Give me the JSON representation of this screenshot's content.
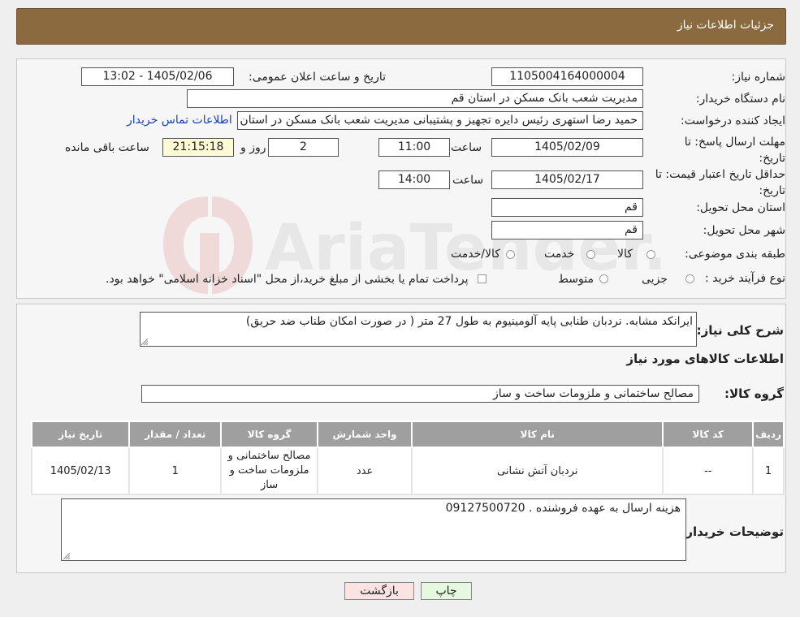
{
  "header": {
    "title": "جزئیات اطلاعات نیاز"
  },
  "form": {
    "need_number_label": "شماره نیاز:",
    "need_number": "1105004164000004",
    "announce_label": "تاریخ و ساعت اعلان عمومی:",
    "announce_value": "1405/02/06 - 13:02",
    "buyer_org_label": "نام دستگاه خریدار:",
    "buyer_org": "مدیریت شعب بانک مسکن در استان قم",
    "requester_label": "ایجاد کننده درخواست:",
    "requester": "حمید رضا استهری رئیس دایره تجهیز و پشتیبانی مدیریت شعب بانک مسکن در استان قم",
    "contact_link": "اطلاعات تماس خریدار",
    "deadline_label": "مهلت ارسال پاسخ: تا تاریخ:",
    "deadline_date": "1405/02/09",
    "time_label": "ساعت",
    "deadline_time": "11:00",
    "days": "2",
    "days_label": "روز و",
    "remaining_time": "21:15:18",
    "remaining_label": "ساعت باقی مانده",
    "price_validity_label": "حداقل تاریخ اعتبار قیمت: تا تاریخ:",
    "price_validity_date": "1405/02/17",
    "price_validity_time": "14:00",
    "province_label": "استان محل تحویل:",
    "province": "قم",
    "city_label": "شهر محل تحویل:",
    "city": "قم",
    "category_label": "طبقه بندی موضوعی:",
    "category_options": [
      "کالا",
      "خدمت",
      "کالا/خدمت"
    ],
    "process_label": "نوع فرآیند خرید :",
    "process_options": [
      "جزیی",
      "متوسط"
    ],
    "payment_note": "پرداخت تمام یا بخشی از مبلغ خرید،از محل \"اسناد خزانه اسلامی\" خواهد بود."
  },
  "summary": {
    "desc_label": "شرح کلی نیاز:",
    "desc_value": "ایرانکد مشابه. نردبان طنابی پایه آلومینیوم به طول 27 متر ( در صورت امکان طناب ضد حریق)",
    "goods_info_title": "اطلاعات کالاهای مورد نیاز",
    "goods_group_label": "گروه کالا:",
    "goods_group_value": "مصالح ساختمانی و ملزومات ساخت و ساز"
  },
  "table": {
    "headers": [
      "ردیف",
      "کد کالا",
      "نام کالا",
      "واحد شمارش",
      "گروه کالا",
      "تعداد / مقدار",
      "تاریخ نیاز"
    ],
    "rows": [
      [
        "1",
        "--",
        "نردبان آتش نشانی",
        "عدد",
        "مصالح ساختمانی و ملزومات ساخت و ساز",
        "1",
        "1405/02/13"
      ]
    ]
  },
  "buyer_notes": {
    "label": "توضیحات خریدار:",
    "value": "هزینه ارسال به عهده فروشنده . 09127500720"
  },
  "buttons": {
    "print": "چاپ",
    "back": "بازگشت"
  },
  "watermark": {
    "text": "AriaTender.neT"
  },
  "colors": {
    "header_bg": "#8c6a3f",
    "table_header_bg": "#9f9f9f",
    "back_button_bg": "#fbe3e3",
    "print_button_bg": "#e6f8e0",
    "link": "#1b3fc1"
  }
}
